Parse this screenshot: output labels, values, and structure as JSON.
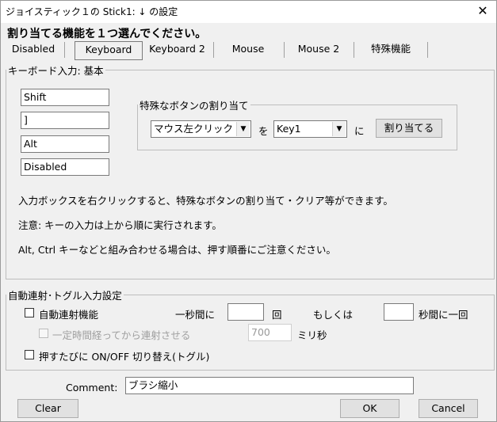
{
  "window": {
    "title": "ジョイスティック１の Stick1: ↓ の設定",
    "close_glyph": "✕"
  },
  "instruction": "割り当てる機能を１つ選んでください。",
  "tabs": [
    {
      "label": "Disabled",
      "active": false
    },
    {
      "label": "Keyboard",
      "active": true
    },
    {
      "label": "Keyboard 2",
      "active": false
    },
    {
      "label": "Mouse",
      "active": false
    },
    {
      "label": "Mouse 2",
      "active": false
    },
    {
      "label": "特殊機能",
      "active": false
    }
  ],
  "keyboard_group": {
    "legend": "キーボード入力: 基本",
    "key_fields": [
      "Shift",
      "]",
      "Alt",
      "Disabled"
    ],
    "special_group": {
      "legend": "特殊なボタンの割り当て",
      "button_select": "マウス左クリック",
      "wo_label": "を",
      "key_select": "Key1",
      "ni_label": "に",
      "assign_button": "割り当てる"
    },
    "notes": [
      "入力ボックスを右クリックすると、特殊なボタンの割り当て・クリア等ができます。",
      "注意: キーの入力は上から順に実行されます。",
      "Alt, Ctrl キーなどと組み合わせる場合は、押す順番にご注意ください。"
    ]
  },
  "auto_group": {
    "legend": "自動連射･トグル入力設定",
    "auto_fire_label": "自動連射機能",
    "per_second_label": "一秒間に",
    "times_value": "",
    "times_label": "回",
    "or_label": "もしくは",
    "seconds_value": "",
    "seconds_label": "秒間に一回",
    "delay_label": "一定時間経ってから連射させる",
    "delay_value": "700",
    "delay_unit": "ミリ秒",
    "toggle_label": "押すたびに ON/OFF 切り替え(トグル)"
  },
  "comment": {
    "label": "Comment:",
    "value": "ブラシ縮小"
  },
  "buttons": {
    "clear": "Clear",
    "ok": "OK",
    "cancel": "Cancel"
  }
}
